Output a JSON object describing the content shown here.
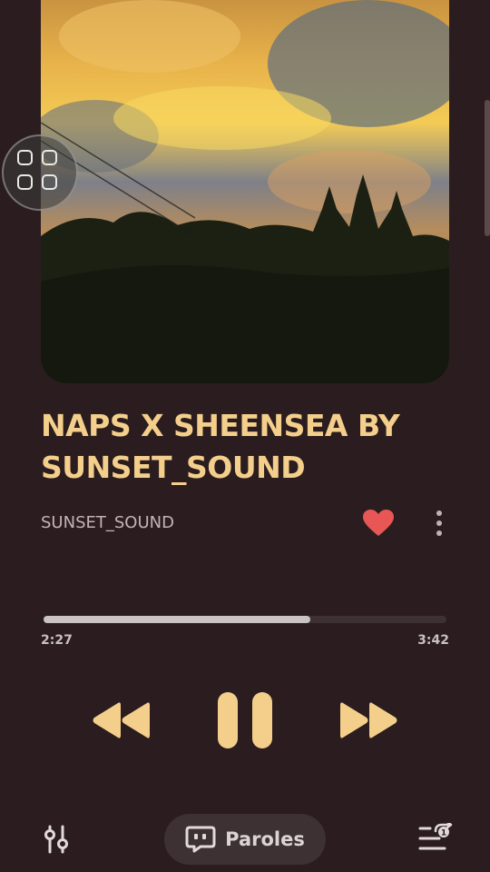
{
  "song": {
    "title": "NAPS X SHEENSEA BY SUNSET_SOUND",
    "artist": "SUNSET_SOUND",
    "liked": true
  },
  "playback": {
    "current_time": "2:27",
    "total_time": "3:42",
    "progress_fraction": 0.662,
    "state": "playing"
  },
  "bottom_bar": {
    "lyrics_label": "Paroles"
  },
  "colors": {
    "background": "#2b1d1f",
    "accent": "#f4cf8c",
    "heart": "#e85656"
  },
  "icons": {
    "floating": "grid-four-icon",
    "like": "heart-icon",
    "more": "more-vertical-icon",
    "rewind": "rewind-icon",
    "pause": "pause-icon",
    "forward": "fast-forward-icon",
    "equalizer": "equalizer-icon",
    "lyrics": "lyrics-icon",
    "queue": "queue-icon"
  }
}
